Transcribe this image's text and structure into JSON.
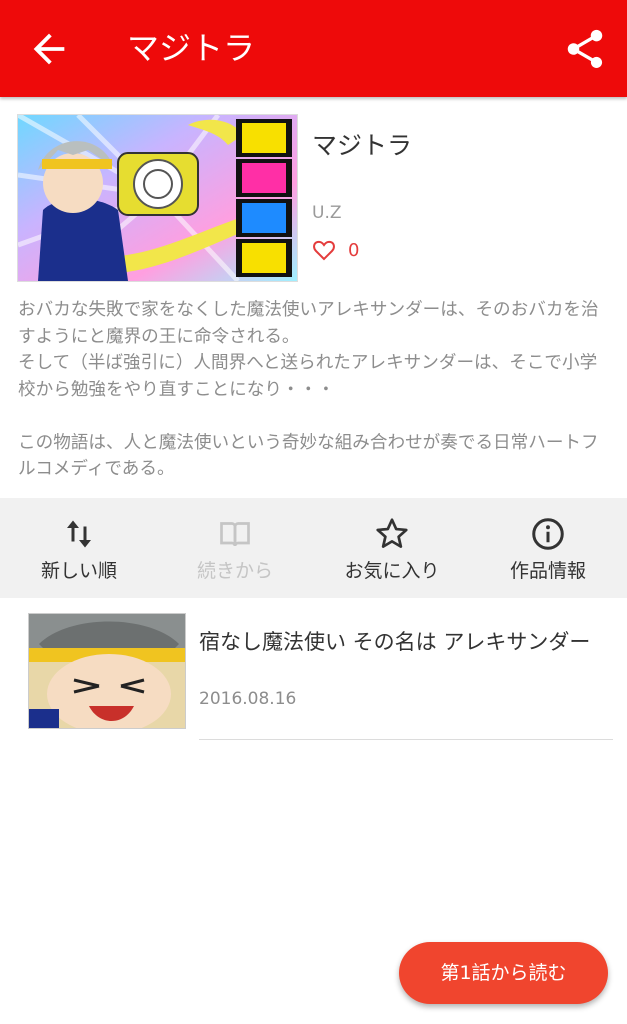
{
  "header": {
    "title": "マジトラ",
    "back_icon": "arrow-back-icon",
    "share_icon": "share-icon",
    "background": "#ee0a0a"
  },
  "work": {
    "title": "マジトラ",
    "author": "U.Z",
    "like_count": "0",
    "description": "おバカな失敗で家をなくした魔法使いアレキサンダーは、そのおバカを治すようにと魔界の王に命令される。\nそして（半ば強引に）人間界へと送られたアレキサンダーは、そこで小学校から勉強をやり直すことになり・・・\n\nこの物語は、人と魔法使いという奇妙な組み合わせが奏でる日常ハートフルコメディである。"
  },
  "actions": [
    {
      "label": "新しい順",
      "icon": "sort-arrows-icon",
      "enabled": true
    },
    {
      "label": "続きから",
      "icon": "book-icon",
      "enabled": false
    },
    {
      "label": "お気に入り",
      "icon": "star-icon",
      "enabled": true
    },
    {
      "label": "作品情報",
      "icon": "info-icon",
      "enabled": true
    }
  ],
  "episodes": [
    {
      "title": "宿なし魔法使い その名は アレキサンダー",
      "date": "2016.08.16"
    }
  ],
  "fab": {
    "label": "第1話から読む",
    "color": "#f0452e"
  }
}
